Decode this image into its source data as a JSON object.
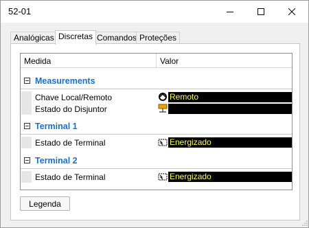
{
  "window": {
    "title": "52-01"
  },
  "tabs": [
    {
      "label": "Analógicas",
      "active": false
    },
    {
      "label": "Discretas",
      "active": true
    },
    {
      "label": "Comandos",
      "active": false
    },
    {
      "label": "Proteções",
      "active": false
    }
  ],
  "grid": {
    "columns": {
      "medida": "Medida",
      "valor": "Valor"
    },
    "groups": [
      {
        "title": "Measurements",
        "rows": [
          {
            "label": "Chave Local/Remoto",
            "value": "Remoto",
            "icon": "local-remote-switch-icon"
          },
          {
            "label": "Estado do Disjuntor",
            "value": "",
            "icon": "breaker-state-icon"
          }
        ]
      },
      {
        "title": "Terminal 1",
        "rows": [
          {
            "label": "Estado de Terminal",
            "value": "Energizado",
            "icon": "terminal-state-icon"
          }
        ]
      },
      {
        "title": "Terminal 2",
        "rows": [
          {
            "label": "Estado de Terminal",
            "value": "Energizado",
            "icon": "terminal-state-icon"
          }
        ]
      }
    ]
  },
  "buttons": {
    "legend": "Legenda"
  },
  "colors": {
    "group_title": "#1a6fc9",
    "value_bg": "#000000",
    "value_text": "#ffff55"
  }
}
